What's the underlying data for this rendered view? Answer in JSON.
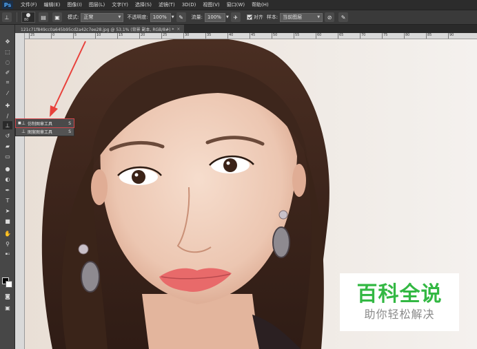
{
  "app": {
    "logo": "Ps"
  },
  "menu": [
    "文件(F)",
    "编辑(E)",
    "图像(I)",
    "图层(L)",
    "文字(Y)",
    "选择(S)",
    "滤镜(T)",
    "3D(D)",
    "视图(V)",
    "窗口(W)",
    "帮助(H)"
  ],
  "options": {
    "brush_size": "80",
    "mode_label": "模式:",
    "mode_value": "正常",
    "opacity_label": "不透明度:",
    "opacity_value": "100%",
    "flow_label": "流量:",
    "flow_value": "100%",
    "align_label": "对齐",
    "align_checked": true,
    "sample_label": "样本:",
    "sample_value": "当前图层"
  },
  "document": {
    "tab_title": "121c71f849cc0a645b95cd2a42c7ee28.jpg @ 53.1% (背景 副本, RGB/8#) *",
    "close_glyph": "×"
  },
  "ruler": {
    "ticks": [
      "25",
      "0",
      "5",
      "10",
      "15",
      "20",
      "25",
      "30",
      "35",
      "40",
      "45",
      "50",
      "55",
      "60",
      "65",
      "70",
      "75",
      "80",
      "85",
      "90"
    ]
  },
  "toolbar": {
    "tools": [
      "move-tool",
      "marquee-tool",
      "lasso-tool",
      "quick-select-tool",
      "crop-tool",
      "eyedropper-tool",
      "healing-brush-tool",
      "brush-tool",
      "clone-stamp-tool",
      "history-brush-tool",
      "eraser-tool",
      "gradient-tool",
      "blur-tool",
      "dodge-tool",
      "pen-tool",
      "type-tool",
      "path-select-tool",
      "rectangle-tool",
      "hand-tool",
      "zoom-tool"
    ],
    "active_tool": "clone-stamp-tool",
    "foreground_color": "#000000",
    "background_color": "#ffffff"
  },
  "flyout": {
    "items": [
      {
        "label": "仿制图章工具",
        "shortcut": "S",
        "selected": true
      },
      {
        "label": "图案图章工具",
        "shortcut": "S",
        "selected": false
      }
    ],
    "highlight_color": "#d6484f"
  },
  "annotation": {
    "arrow_color": "#e8413b"
  },
  "watermark": {
    "title": "百科全说",
    "subtitle": "助你轻松解决",
    "title_color": "#33b843"
  }
}
